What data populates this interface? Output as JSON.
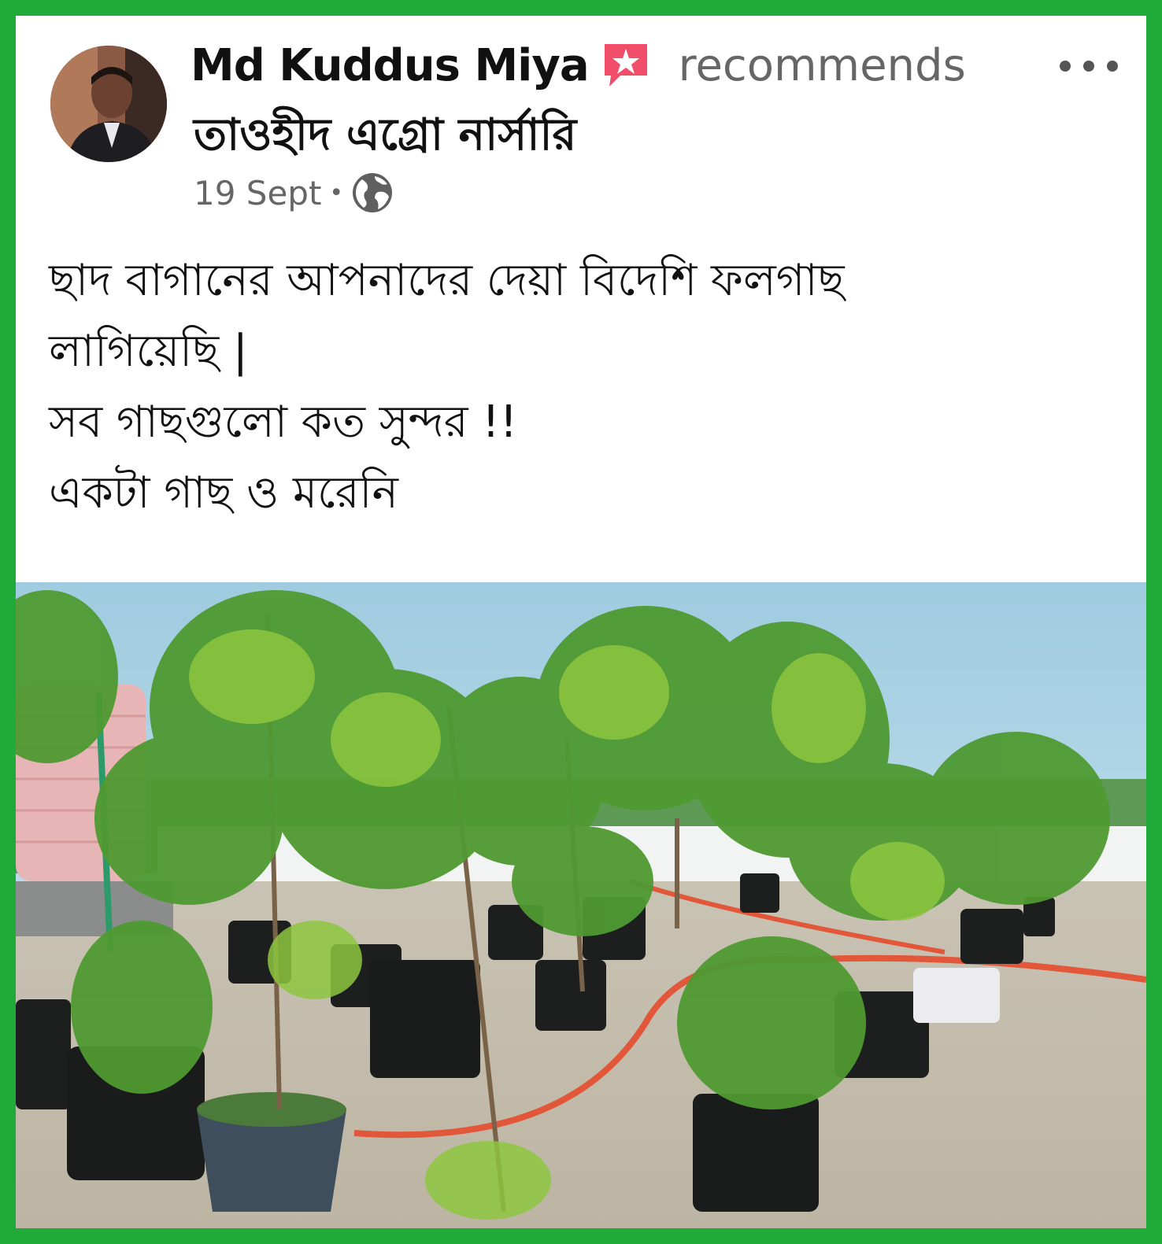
{
  "post": {
    "author": "Md Kuddus Miya",
    "action": "recommends",
    "page_name": "তাওহীদ এগ্রো নার্সারি",
    "date": "19 Sept",
    "separator": "•",
    "privacy_icon": "globe-icon",
    "author_badge_icon": "recommend-icon",
    "more_icon": "more-options-icon",
    "text_lines": [
      "ছাদ বাগানের আপনাদের দেয়া বিদেশি ফলগাছ",
      "লাগিয়েছি |",
      "সব গাছগুলো কত সুন্দর !!",
      "একটা গাছ ও মরেনি"
    ]
  },
  "colors": {
    "frame_green": "#1faa3a",
    "badge_pink": "#f04e6a",
    "text_dark": "#111111",
    "text_muted": "#666666"
  }
}
